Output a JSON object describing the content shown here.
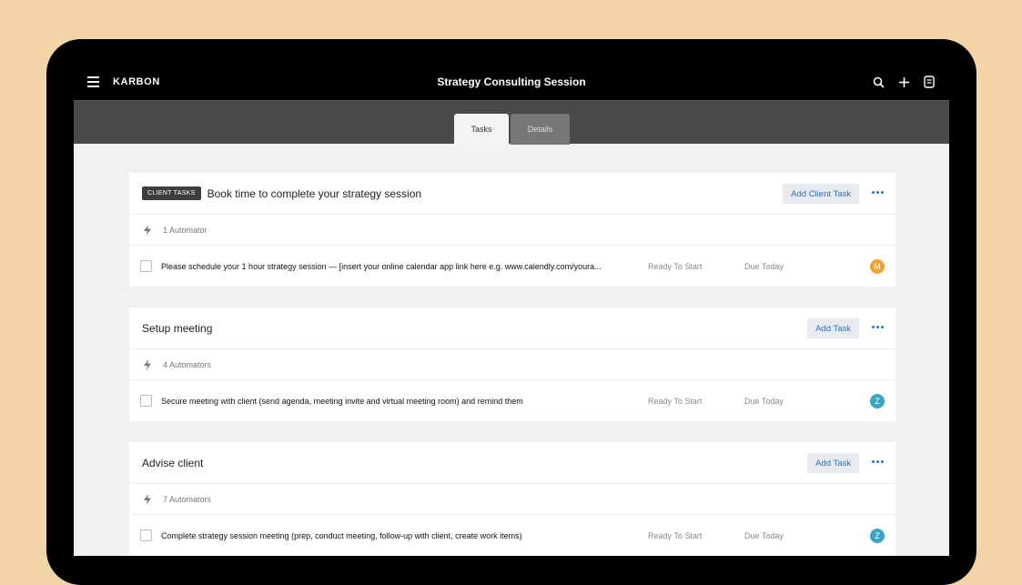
{
  "app": {
    "brand": "KARBON",
    "title": "Strategy Consulting Session"
  },
  "tabs": [
    {
      "label": "Tasks",
      "active": true
    },
    {
      "label": "Details",
      "active": false
    }
  ],
  "sections": [
    {
      "badge": "CLIENT TASKS",
      "title": "Book time to complete your strategy session",
      "add_label": "Add Client Task",
      "automators": "1 Automator",
      "task": {
        "text": "Please schedule your 1 hour strategy session — [insert your online calendar app link here e.g. www.calendly.com/youra...",
        "status": "Ready To Start",
        "due": "Due Today",
        "avatar": "M",
        "avatar_color": "#f0a330"
      }
    },
    {
      "badge": "",
      "title": "Setup meeting",
      "add_label": "Add Task",
      "automators": "4 Automators",
      "task": {
        "text": "Secure meeting with client (send agenda, meeting invite and virtual meeting room) and remind them",
        "status": "Ready To Start",
        "due": "Due Today",
        "avatar": "Z",
        "avatar_color": "#3aa6c2"
      }
    },
    {
      "badge": "",
      "title": "Advise client",
      "add_label": "Add Task",
      "automators": "7 Automators",
      "task": {
        "text": "Complete strategy session meeting (prep, conduct meeting, follow-up with client, create work items)",
        "status": "Ready To Start",
        "due": "Due Today",
        "avatar": "Z",
        "avatar_color": "#3aa6c2"
      }
    }
  ],
  "icons": [
    "menu-icon",
    "search-icon",
    "plus-icon",
    "notes-icon",
    "bolt-icon",
    "more-icon"
  ]
}
